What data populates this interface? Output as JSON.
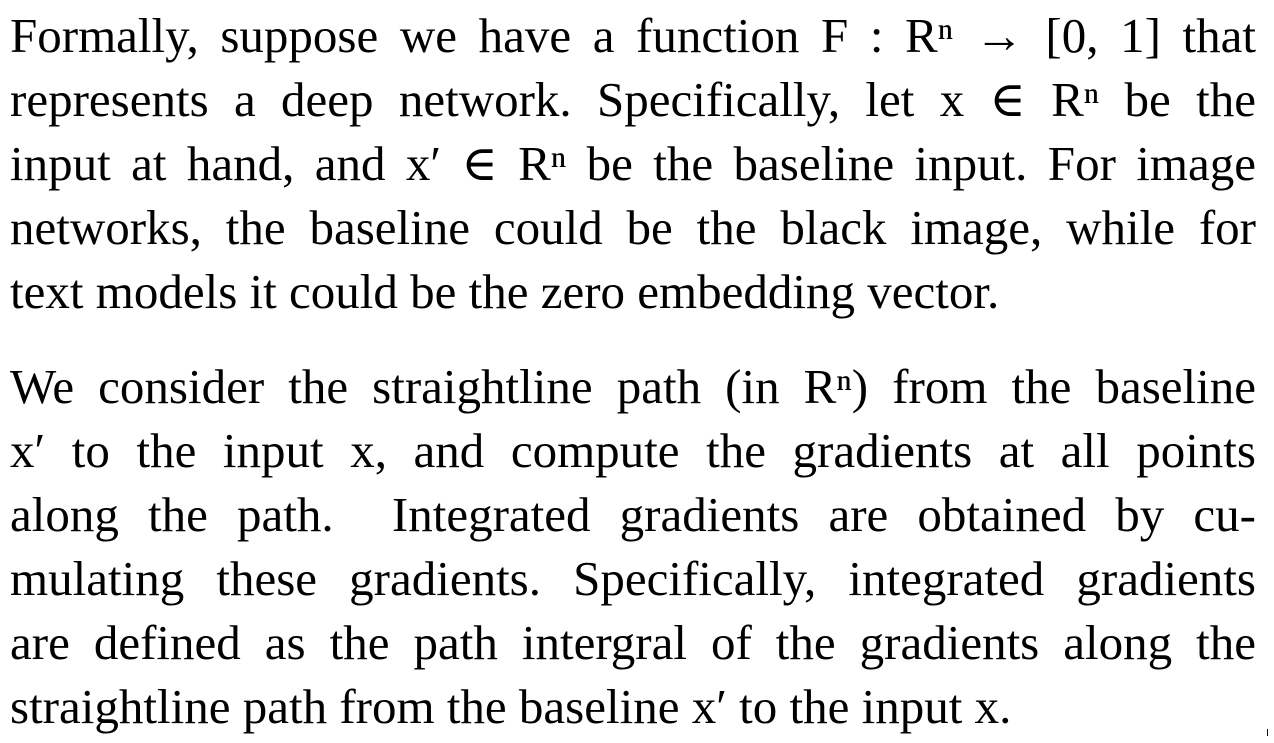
{
  "paragraphs": [
    {
      "lines": [
        "Formally, suppose we have a function F : Rⁿ → [0, 1] that",
        "represents a deep network. Specifically, let x ∈ Rⁿ be the",
        "input at hand, and x′ ∈ Rⁿ be the baseline input. For image",
        "networks, the baseline could be the black image, while for",
        "text models it could be the zero embedding vector."
      ]
    },
    {
      "lines": [
        "We consider the straightline path (in Rⁿ) from the baseline",
        "x′ to the input x, and compute the gradients at all points",
        "along the path.  Integrated gradients are obtained by cu-",
        "mulating these gradients. Specifically, integrated gradients",
        "are defined as the path intergral of the gradients along the",
        "straightline path from the baseline x′ to the input x."
      ]
    }
  ],
  "corner_glyph": "I"
}
